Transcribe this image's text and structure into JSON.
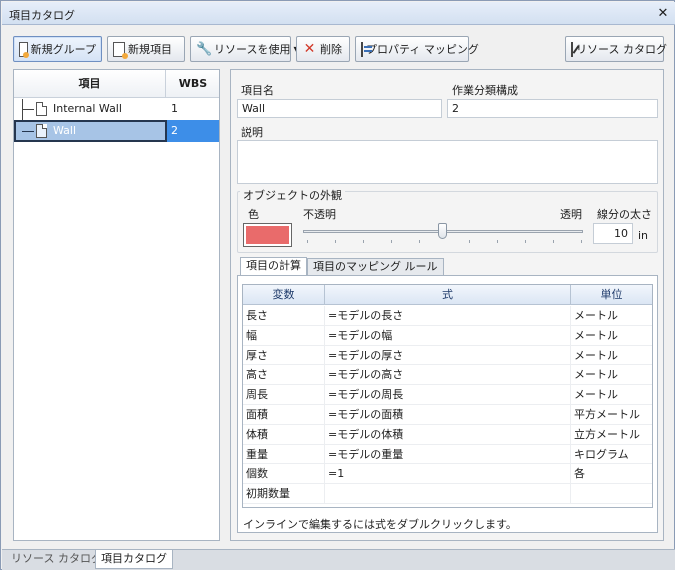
{
  "window": {
    "title": "項目カタログ",
    "close_glyph": "✕"
  },
  "toolbar": {
    "new_group": "新規グループ",
    "new_item": "新規項目",
    "use_resource": "リソースを使用",
    "delete": "削除",
    "property_mapping": "プロパティ マッピング",
    "resource_catalog": "リソース カタログ"
  },
  "tree": {
    "col_item": "項目",
    "col_wbs": "WBS",
    "rows": [
      {
        "label": "Internal Wall",
        "wbs": "1"
      },
      {
        "label": "Wall",
        "wbs": "2",
        "selected": true
      }
    ]
  },
  "details": {
    "name_label": "項目名",
    "name_value": "Wall",
    "wbs_label": "作業分類構成",
    "wbs_value": "2",
    "desc_label": "説明",
    "desc_value": ""
  },
  "appearance": {
    "title": "オブジェクトの外観",
    "color_label": "色",
    "color_value": "#e96b6b",
    "opaque_label": "不透明",
    "transparent_label": "透明",
    "transparency_level": 0.5,
    "line_width_label": "線分の太さ",
    "line_width_value": "10",
    "line_width_unit": "in"
  },
  "tabs": [
    {
      "label": "項目の計算",
      "selected": true
    },
    {
      "label": "項目のマッピング ルール",
      "selected": false
    }
  ],
  "calc_table": {
    "headers": [
      "変数",
      "式",
      "単位"
    ],
    "rows": [
      {
        "var": "長さ",
        "formula": "=モデルの長さ",
        "unit": "メートル"
      },
      {
        "var": "幅",
        "formula": "=モデルの幅",
        "unit": "メートル"
      },
      {
        "var": "厚さ",
        "formula": "=モデルの厚さ",
        "unit": "メートル"
      },
      {
        "var": "高さ",
        "formula": "=モデルの高さ",
        "unit": "メートル"
      },
      {
        "var": "周長",
        "formula": "=モデルの周長",
        "unit": "メートル"
      },
      {
        "var": "面積",
        "formula": "=モデルの面積",
        "unit": "平方メートル"
      },
      {
        "var": "体積",
        "formula": "=モデルの体積",
        "unit": "立方メートル"
      },
      {
        "var": "重量",
        "formula": "=モデルの重量",
        "unit": "キログラム"
      },
      {
        "var": "個数",
        "formula": "=1",
        "unit": "各"
      },
      {
        "var": "初期数量",
        "formula": "",
        "unit": ""
      }
    ],
    "hint": "インラインで編集するには式をダブルクリックします。"
  },
  "bottom_tabs": {
    "resource_catalog": "リソース カタログ",
    "item_catalog": "項目カタログ"
  }
}
